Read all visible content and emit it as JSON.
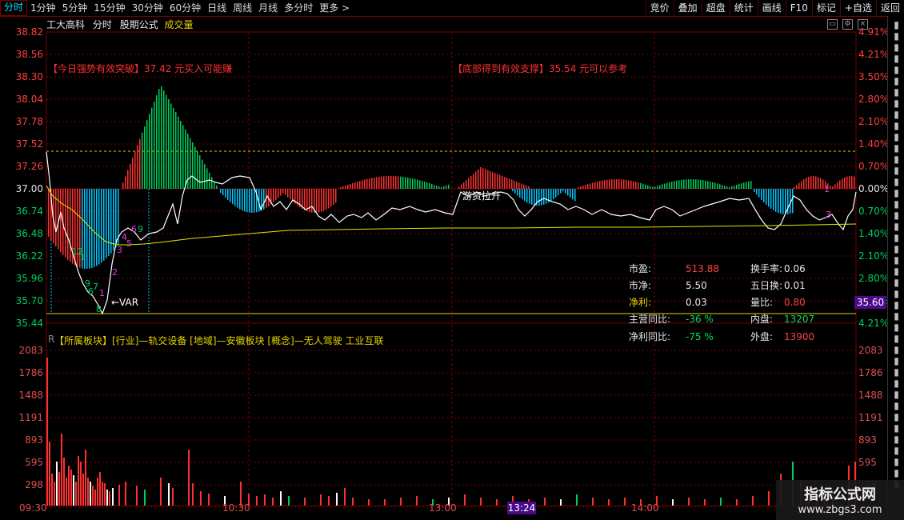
{
  "toolbar": {
    "timeframes": [
      "分时",
      "1分钟",
      "5分钟",
      "15分钟",
      "30分钟",
      "60分钟",
      "日线",
      "周线",
      "月线",
      "多分时",
      "更多 >"
    ],
    "active": 0,
    "buttons": [
      "竞价",
      "叠加",
      "超盘",
      "统计",
      "画线",
      "F10",
      "标记",
      "+自选",
      "返回"
    ]
  },
  "title": {
    "name": "工大高科",
    "mode": "分时",
    "formula": "股期公式",
    "volume": "成交量"
  },
  "price_axis": {
    "left": [
      "38.82",
      "38.56",
      "38.30",
      "38.04",
      "37.78",
      "37.52",
      "37.26",
      "37.00",
      "36.74",
      "36.48",
      "36.22",
      "35.96",
      "35.70",
      "35.44"
    ],
    "right": [
      "4.91%",
      "4.21%",
      "3.50%",
      "2.80%",
      "2.10%",
      "1.40%",
      "0.70%",
      "0.00%",
      "0.70%",
      "1.40%",
      "2.10%",
      "2.80%",
      "3.50%",
      "4.21%"
    ]
  },
  "volume_axis": [
    "2083",
    "1786",
    "1488",
    "1191",
    "893",
    "595",
    "298"
  ],
  "time_axis": [
    "09:30",
    "10:30",
    "13:00",
    "14:00"
  ],
  "cursor_time": "13:24",
  "cursor_price": "35.60",
  "annotations": {
    "left_signal": "【今日强势有效突破】37.42 元买入可能赚",
    "right_signal": "【底部得到有效支撑】35.54 元可以参考",
    "funds": "游资拉升",
    "var": "←VAR"
  },
  "board_info": "【所属板块】[行业]—轨交设备 [地域]—安徽板块 [概念]—无人驾驶 工业互联",
  "board_prefix": "R",
  "stats": {
    "pe_label": "市盈:",
    "pe": "513.88",
    "pb_label": "市净:",
    "pb": "5.50",
    "np_label": "净利:",
    "np": "0.03",
    "rev_label": "主营同比:",
    "rev": "-36 %",
    "npy_label": "净利同比:",
    "npy": "-75 %",
    "turnover_label": "换手率:",
    "turnover": "0.06",
    "t5_label": "五日换:",
    "t5": "0.01",
    "vr_label": "量比:",
    "vr": "0.80",
    "inner_label": "内盘:",
    "inner": "13207",
    "outer_label": "外盘:",
    "outer": "13900"
  },
  "watermark": {
    "title": "指标公式网",
    "url": "www.zbgs3.com"
  },
  "colors": {
    "up": "#ff3030",
    "down": "#00c8ff",
    "green": "#00d060",
    "yellow": "#e6d200",
    "grid": "#7a0000",
    "price_line": "#ffffff",
    "avg_line": "#e6e600"
  }
}
